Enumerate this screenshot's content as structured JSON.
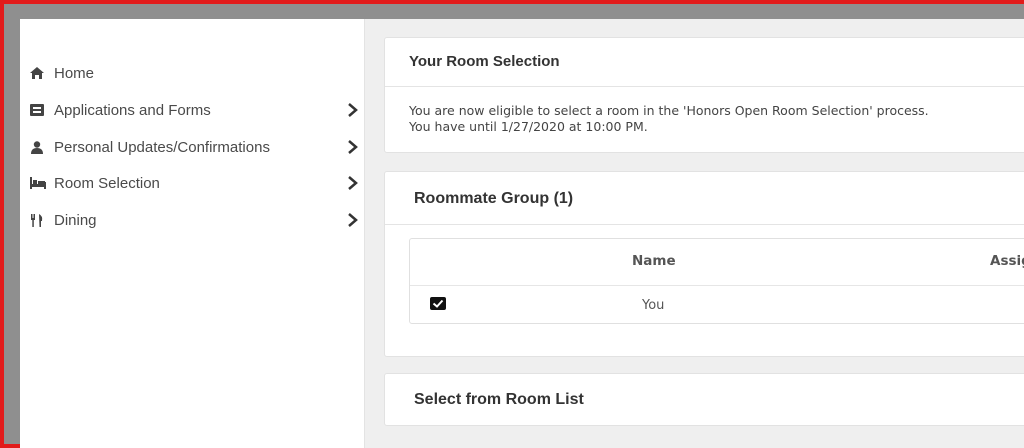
{
  "sidebar": {
    "items": [
      {
        "label": "Home",
        "icon": "home-icon",
        "has_chevron": false
      },
      {
        "label": "Applications and Forms",
        "icon": "form-icon",
        "has_chevron": true
      },
      {
        "label": "Personal Updates/Confirmations",
        "icon": "user-icon",
        "has_chevron": true
      },
      {
        "label": "Room Selection",
        "icon": "bed-icon",
        "has_chevron": true
      },
      {
        "label": "Dining",
        "icon": "utensils-icon",
        "has_chevron": true
      }
    ]
  },
  "room_selection_card": {
    "title": "Your Room Selection",
    "line1": "You are now eligible to select a room in the 'Honors Open Room Selection' process.",
    "line2": "You have until 1/27/2020 at 10:00 PM."
  },
  "roommate_group_card": {
    "title": "Roommate Group (1)",
    "table": {
      "columns": [
        "Name",
        "Assig"
      ],
      "rows": [
        {
          "checked": true,
          "name": "You"
        }
      ]
    }
  },
  "room_list_card": {
    "title": "Select from Room List"
  },
  "colors": {
    "outer_border": "#e21b1b",
    "frame": "#8f8f8f",
    "background": "#efefef",
    "card": "#ffffff",
    "text": "#4a4a4a"
  }
}
